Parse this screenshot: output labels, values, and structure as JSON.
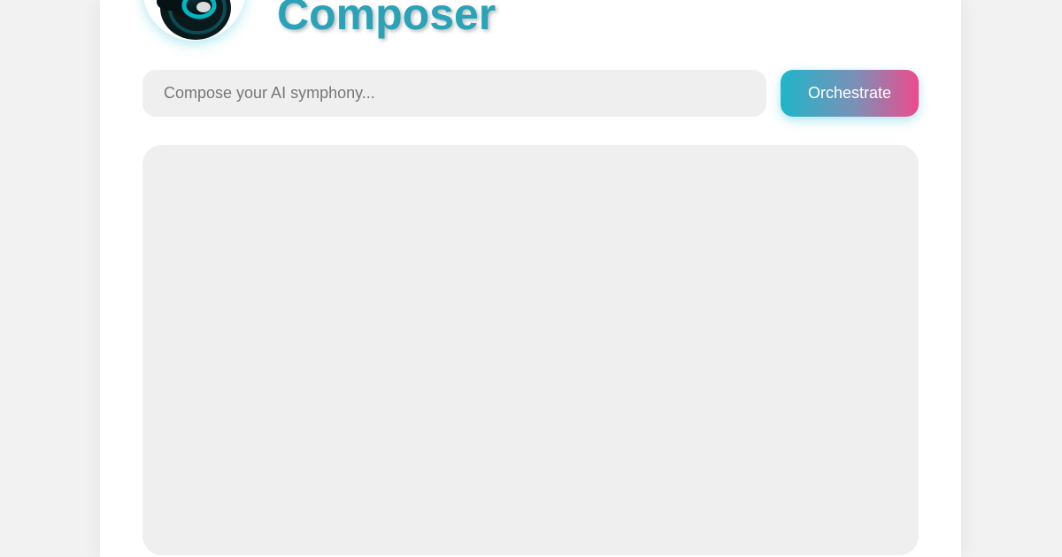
{
  "header": {
    "title": "Composer",
    "logo_icon": "swirl-logo-icon"
  },
  "prompt": {
    "value": "",
    "placeholder": "Compose your AI symphony..."
  },
  "actions": {
    "orchestrate_label": "Orchestrate"
  },
  "colors": {
    "accent": "#2aa3b8",
    "button_gradient_start": "#1fb6c9",
    "button_gradient_end": "#ee4a8c",
    "field_bg": "#efefef"
  }
}
